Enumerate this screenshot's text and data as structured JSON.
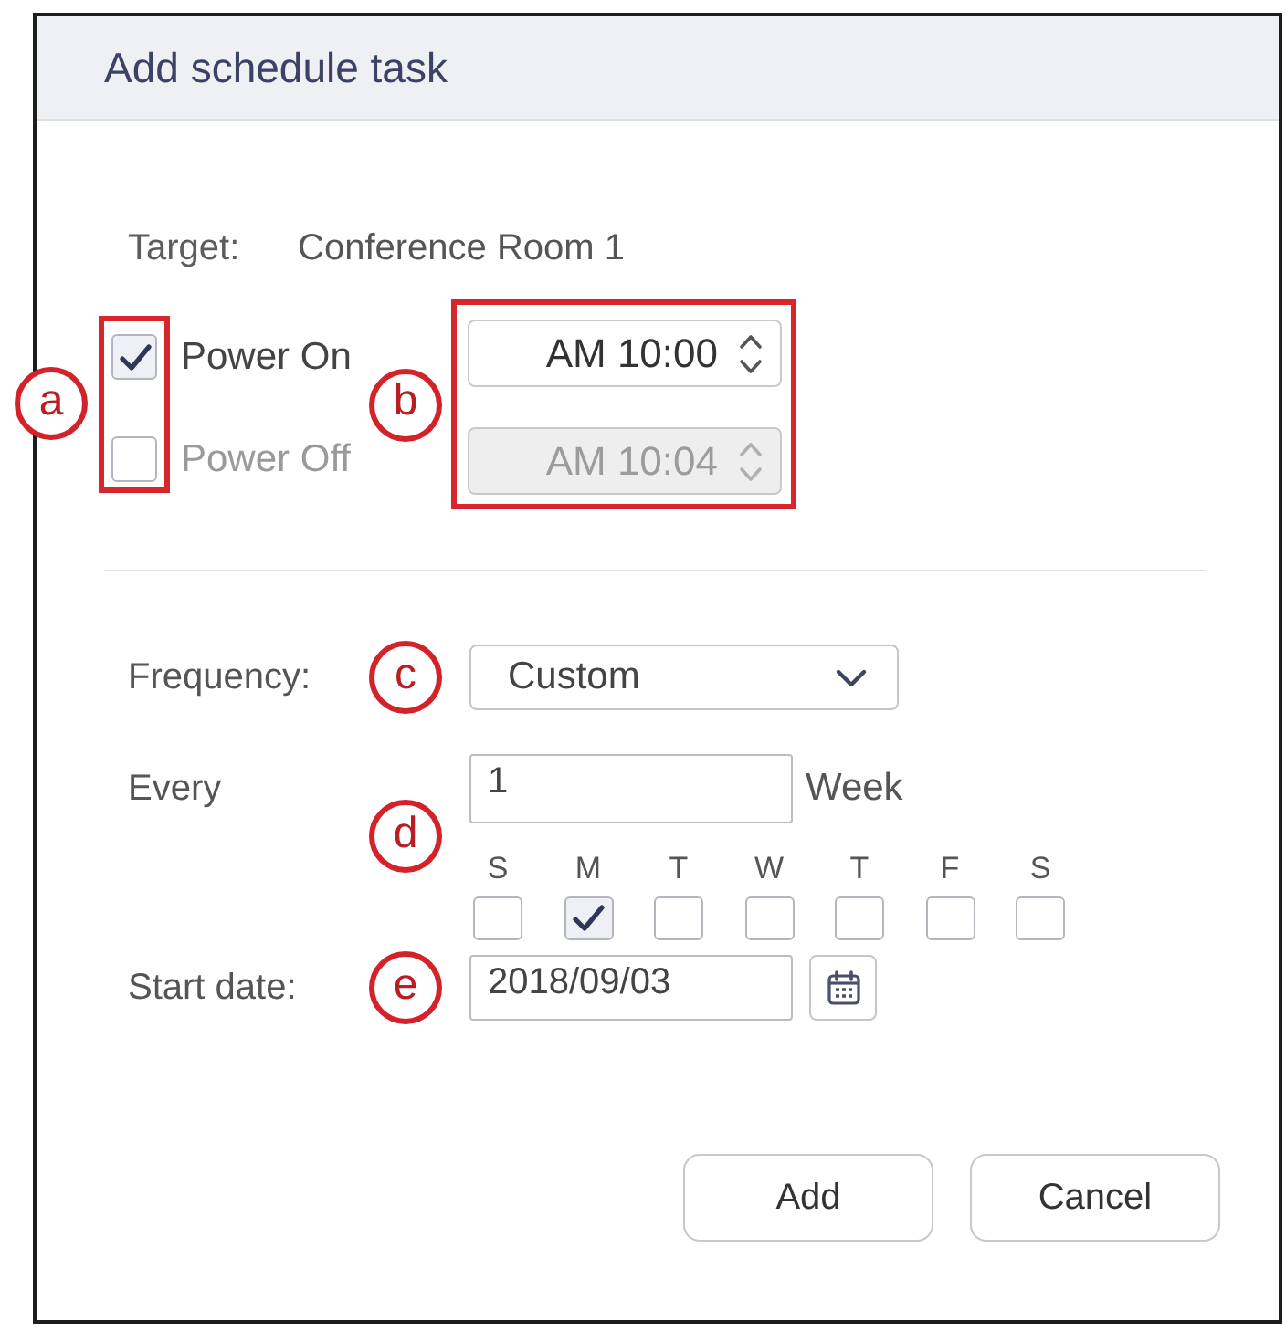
{
  "dialog": {
    "title": "Add schedule task"
  },
  "target": {
    "label": "Target:",
    "value": "Conference Room 1"
  },
  "power": {
    "callout": "a",
    "framed": true,
    "options": [
      {
        "label": "Power On",
        "checked": true
      },
      {
        "label": "Power Off",
        "checked": false
      }
    ]
  },
  "times": {
    "callout": "b",
    "framed": true,
    "fields": [
      {
        "value": "AM 10:00",
        "disabled": false
      },
      {
        "value": "AM 10:04",
        "disabled": true
      }
    ]
  },
  "frequency": {
    "label": "Frequency:",
    "callout": "c",
    "value": "Custom"
  },
  "every": {
    "label": "Every",
    "callout": "d",
    "value": "1",
    "unit": "Week",
    "weekdays": [
      {
        "label": "S",
        "checked": false
      },
      {
        "label": "M",
        "checked": true
      },
      {
        "label": "T",
        "checked": false
      },
      {
        "label": "W",
        "checked": false
      },
      {
        "label": "T",
        "checked": false
      },
      {
        "label": "F",
        "checked": false
      },
      {
        "label": "S",
        "checked": false
      }
    ]
  },
  "start_date": {
    "label": "Start date:",
    "callout": "e",
    "value": "2018/09/03"
  },
  "buttons": [
    {
      "label": "Add"
    },
    {
      "label": "Cancel"
    }
  ]
}
